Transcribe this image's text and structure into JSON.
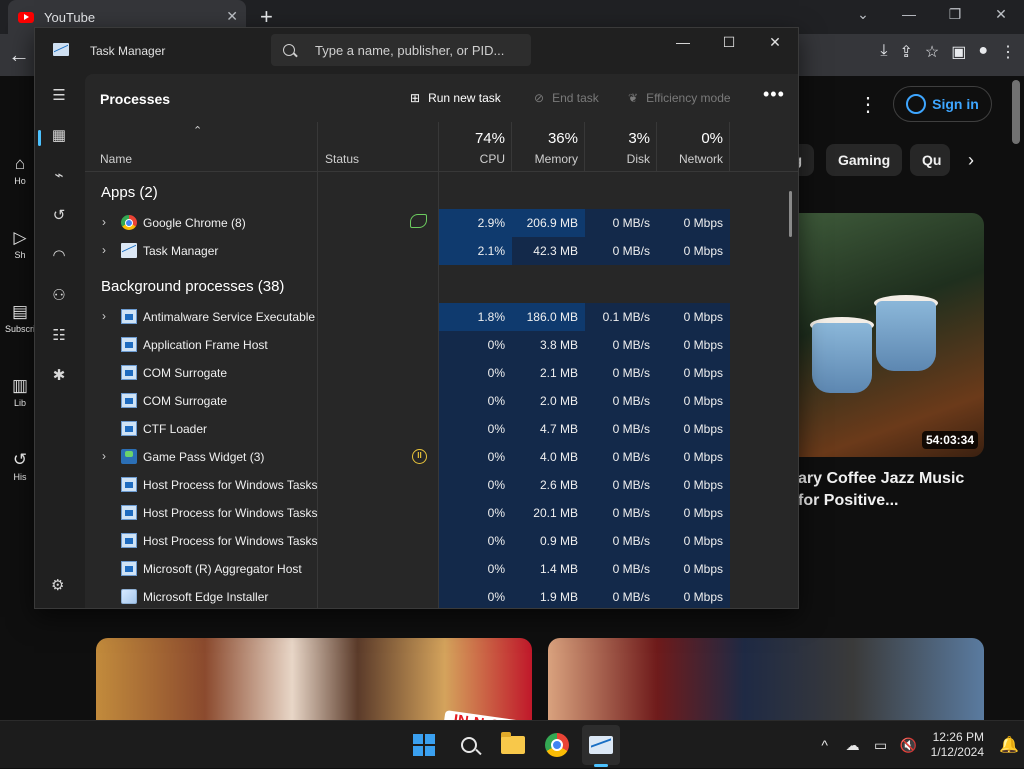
{
  "browser": {
    "tab_title": "YouTube",
    "tab_close": "✕",
    "new_tab": "+",
    "back": "←",
    "window_controls": [
      "⌄",
      "—",
      "❐",
      "✕"
    ],
    "toolbar_icons": [
      "download",
      "share",
      "star",
      "sidebar",
      "profile",
      "menu"
    ]
  },
  "youtube": {
    "sidebar": [
      {
        "label": "Ho",
        "icon": "home-icon"
      },
      {
        "label": "Sh",
        "icon": "shorts-icon"
      },
      {
        "label": "Subscri",
        "icon": "subscriptions-icon"
      },
      {
        "label": "Lib",
        "icon": "library-icon"
      },
      {
        "label": "His",
        "icon": "history-icon"
      }
    ],
    "sign_in": "Sign in",
    "chips": [
      "g",
      "Gaming",
      "Qu"
    ],
    "chip_next": "›",
    "video": {
      "duration": "54:03:34",
      "title": "ary Coffee Jazz Music\nfor Positive..."
    },
    "thumb_text": "IN-N-OUT"
  },
  "task_manager": {
    "title": "Task Manager",
    "search_placeholder": "Type a name, publisher, or PID...",
    "window_controls": [
      "—",
      "☐",
      "✕"
    ],
    "heading": "Processes",
    "actions": {
      "run_new_task": "Run new task",
      "end_task": "End task",
      "efficiency_mode": "Efficiency mode",
      "more": "•••"
    },
    "columns": {
      "name": "Name",
      "status": "Status",
      "cpu": {
        "pct": "74%",
        "label": "CPU"
      },
      "memory": {
        "pct": "36%",
        "label": "Memory"
      },
      "disk": {
        "pct": "3%",
        "label": "Disk"
      },
      "network": {
        "pct": "0%",
        "label": "Network"
      }
    },
    "groups": {
      "apps": "Apps (2)",
      "background": "Background processes (38)"
    },
    "apps": [
      {
        "name": "Google Chrome (8)",
        "cpu": "2.9%",
        "memory": "206.9 MB",
        "disk": "0 MB/s",
        "network": "0 Mbps",
        "status": "efficiency-leaf"
      },
      {
        "name": "Task Manager",
        "cpu": "2.1%",
        "memory": "42.3 MB",
        "disk": "0 MB/s",
        "network": "0 Mbps",
        "status": ""
      }
    ],
    "background": [
      {
        "name": "Antimalware Service Executable",
        "cpu": "1.8%",
        "memory": "186.0 MB",
        "disk": "0.1 MB/s",
        "network": "0 Mbps"
      },
      {
        "name": "Application Frame Host",
        "cpu": "0%",
        "memory": "3.8 MB",
        "disk": "0 MB/s",
        "network": "0 Mbps"
      },
      {
        "name": "COM Surrogate",
        "cpu": "0%",
        "memory": "2.1 MB",
        "disk": "0 MB/s",
        "network": "0 Mbps"
      },
      {
        "name": "COM Surrogate",
        "cpu": "0%",
        "memory": "2.0 MB",
        "disk": "0 MB/s",
        "network": "0 Mbps"
      },
      {
        "name": "CTF Loader",
        "cpu": "0%",
        "memory": "4.7 MB",
        "disk": "0 MB/s",
        "network": "0 Mbps"
      },
      {
        "name": "Game Pass Widget (3)",
        "cpu": "0%",
        "memory": "4.0 MB",
        "disk": "0 MB/s",
        "network": "0 Mbps"
      },
      {
        "name": "Host Process for Windows Tasks",
        "cpu": "0%",
        "memory": "2.6 MB",
        "disk": "0 MB/s",
        "network": "0 Mbps"
      },
      {
        "name": "Host Process for Windows Tasks",
        "cpu": "0%",
        "memory": "20.1 MB",
        "disk": "0 MB/s",
        "network": "0 Mbps"
      },
      {
        "name": "Host Process for Windows Tasks",
        "cpu": "0%",
        "memory": "0.9 MB",
        "disk": "0 MB/s",
        "network": "0 Mbps"
      },
      {
        "name": "Microsoft (R) Aggregator Host",
        "cpu": "0%",
        "memory": "1.4 MB",
        "disk": "0 MB/s",
        "network": "0 Mbps"
      },
      {
        "name": "Microsoft Edge Installer",
        "cpu": "0%",
        "memory": "1.9 MB",
        "disk": "0 MB/s",
        "network": "0 Mbps"
      }
    ]
  },
  "taskbar": {
    "apps": [
      "start",
      "search",
      "file-explorer",
      "chrome",
      "task-manager"
    ],
    "tray_icons": [
      "^",
      "☁",
      "▭",
      "🔇"
    ],
    "time": "12:26 PM",
    "date": "1/12/2024",
    "bell": "🔔"
  }
}
